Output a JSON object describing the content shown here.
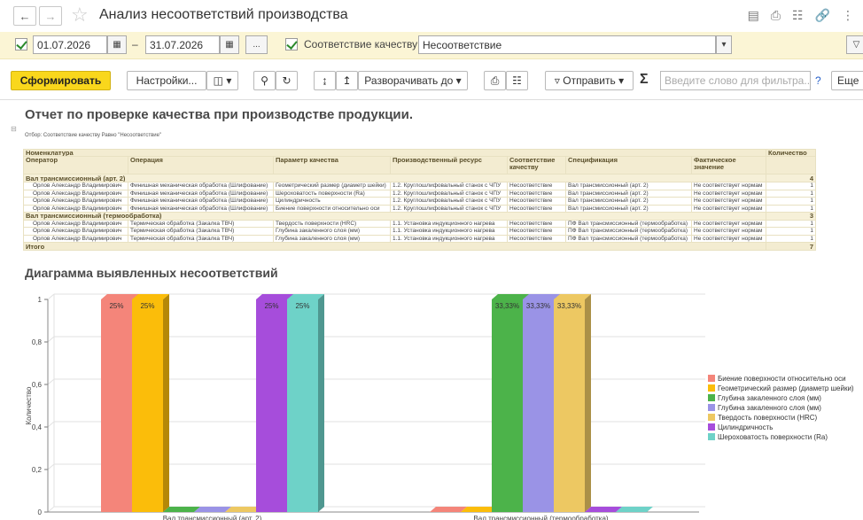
{
  "window": {
    "title": "Анализ несоответствий производства",
    "icons": [
      "save-icon",
      "print-icon",
      "preview-icon",
      "link-icon",
      "more-icon"
    ]
  },
  "params": {
    "date_from": "01.07.2026",
    "date_to": "31.07.2026",
    "dash": "–",
    "dots": "...",
    "quality_label": "Соответствие качеству:",
    "quality_value": "Несоответствие"
  },
  "toolbar": {
    "generate": "Сформировать",
    "settings": "Настройки...",
    "expand": "Разворачивать до",
    "send": "Отправить",
    "sigma": "Σ",
    "search_placeholder": "Введите слово для фильтра...",
    "help": "?",
    "more": "Еще"
  },
  "report": {
    "title": "Отчет по проверке качества при производстве продукции.",
    "filter": "Отбор:  Соответствие качеству Равно \"Несоответствие\"",
    "headers": {
      "nomenclature": "Номенклатура",
      "quantity": "Количество",
      "operator": "Оператор",
      "operation": "Операция",
      "parameter": "Параметр качества",
      "resource": "Производственный ресурс",
      "conformity": "Соответствие качеству",
      "spec": "Спецификация",
      "actual": "Фактическое значение"
    },
    "groups": [
      {
        "name": "Вал трансмиссионный (арт. 2)",
        "qty": "4",
        "rows": [
          {
            "operator": "Орлов Александр Владимирович",
            "operation": "Финишная механическая обработка (Шлифование)",
            "parameter": "Геометрический размер (диаметр шейки)",
            "resource": "1.2. Круглошлифовальный станок с ЧПУ",
            "conformity": "Несоответствие",
            "spec": "Вал трансмиссионный (арт. 2)",
            "actual": "Не соответствует нормам",
            "qty": "1"
          },
          {
            "operator": "Орлов Александр Владимирович",
            "operation": "Финишная механическая обработка (Шлифование)",
            "parameter": "Шероховатость поверхности (Ra)",
            "resource": "1.2. Круглошлифовальный станок с ЧПУ",
            "conformity": "Несоответствие",
            "spec": "Вал трансмиссионный (арт. 2)",
            "actual": "Не соответствует нормам",
            "qty": "1"
          },
          {
            "operator": "Орлов Александр Владимирович",
            "operation": "Финишная механическая обработка (Шлифование)",
            "parameter": "Цилиндричность",
            "resource": "1.2. Круглошлифовальный станок с ЧПУ",
            "conformity": "Несоответствие",
            "spec": "Вал трансмиссионный (арт. 2)",
            "actual": "Не соответствует нормам",
            "qty": "1"
          },
          {
            "operator": "Орлов Александр Владимирович",
            "operation": "Финишная механическая обработка (Шлифование)",
            "parameter": "Биение поверхности относительно оси",
            "resource": "1.2. Круглошлифовальный станок с ЧПУ",
            "conformity": "Несоответствие",
            "spec": "Вал трансмиссионный (арт. 2)",
            "actual": "Не соответствует нормам",
            "qty": "1"
          }
        ]
      },
      {
        "name": "Вал трансмиссионный (термообработка)",
        "qty": "3",
        "rows": [
          {
            "operator": "Орлов Александр Владимирович",
            "operation": "Термическая обработка (Закалка ТВЧ)",
            "parameter": "Твердость поверхности (HRC)",
            "resource": "1.1. Установка индукционного нагрева",
            "conformity": "Несоответствие",
            "spec": "ПФ Вал трансмиссионный (термообработка)",
            "actual": "Не соответствует нормам",
            "qty": "1"
          },
          {
            "operator": "Орлов Александр Владимирович",
            "operation": "Термическая обработка (Закалка ТВЧ)",
            "parameter": "Глубина закаленного слоя (мм)",
            "resource": "1.1. Установка индукционного нагрева",
            "conformity": "Несоответствие",
            "spec": "ПФ Вал трансмиссионный (термообработка)",
            "actual": "Не соответствует нормам",
            "qty": "1"
          },
          {
            "operator": "Орлов Александр Владимирович",
            "operation": "Термическая обработка (Закалка ТВЧ)",
            "parameter": "Глубина закаленного слоя (мм)",
            "resource": "1.1. Установка индукционного нагрева",
            "conformity": "Несоответствие",
            "spec": "ПФ Вал трансмиссионный (термообработка)",
            "actual": "Не соответствует нормам",
            "qty": "1"
          }
        ]
      }
    ],
    "total_label": "Итого",
    "total_qty": "7",
    "chart_title": "Диаграмма выявленных несоответствий"
  },
  "chart_data": {
    "type": "bar",
    "title": "Диаграмма выявленных несоответствий",
    "ylabel": "Количество",
    "ylim": [
      0,
      1
    ],
    "yticks": [
      "0",
      "0,2",
      "0,4",
      "0,6",
      "0,8",
      "1"
    ],
    "categories": [
      "Вал трансмиссионный (арт. 2)",
      "Вал трансмиссионный (термообработка)"
    ],
    "legend_position": "right",
    "series": [
      {
        "name": "Биение поверхности относительно оси",
        "color": "#f4857a",
        "values": [
          1,
          0
        ],
        "labels": [
          "25%",
          ""
        ]
      },
      {
        "name": "Геометрический размер (диаметр шейки)",
        "color": "#fbbd0a",
        "values": [
          1,
          0
        ],
        "labels": [
          "25%",
          ""
        ]
      },
      {
        "name": "Глубина закаленного слоя (мм)",
        "color": "#4cb34a",
        "values": [
          0,
          1
        ],
        "labels": [
          "",
          "33,33%"
        ]
      },
      {
        "name": "Глубина закаленного слоя (мм)",
        "color": "#9a93e6",
        "values": [
          0,
          1
        ],
        "labels": [
          "",
          "33,33%"
        ]
      },
      {
        "name": "Твердость поверхности (HRC)",
        "color": "#edc862",
        "values": [
          0,
          1
        ],
        "labels": [
          "",
          "33,33%"
        ]
      },
      {
        "name": "Цилиндричность",
        "color": "#a64ddb",
        "values": [
          1,
          0
        ],
        "labels": [
          "25%",
          ""
        ]
      },
      {
        "name": "Шероховатость поверхности (Ra)",
        "color": "#6ed2c8",
        "values": [
          1,
          0
        ],
        "labels": [
          "25%",
          ""
        ]
      }
    ]
  }
}
